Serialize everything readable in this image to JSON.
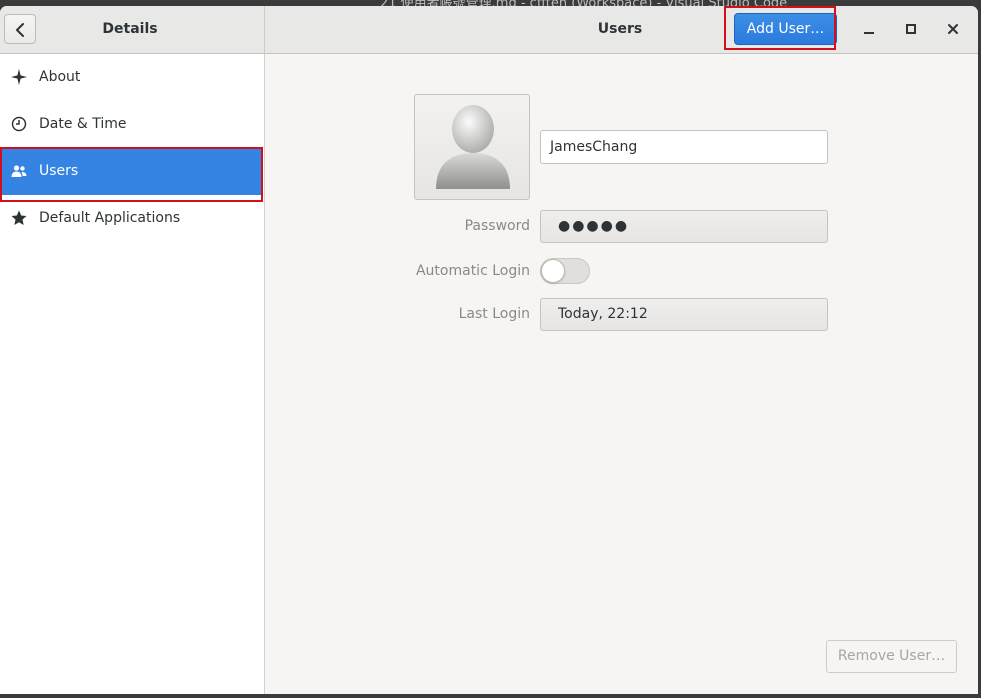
{
  "background_window_title": "21 使用者帳號管理.md - cfften (Workspace) - Visual Studio Code",
  "header": {
    "left_title": "Details",
    "center_title": "Users",
    "add_user_label": "Add User…"
  },
  "sidebar": {
    "items": [
      {
        "label": "About",
        "icon": "sparkle-icon"
      },
      {
        "label": "Date & Time",
        "icon": "clock-icon"
      },
      {
        "label": "Users",
        "icon": "users-icon",
        "selected": true
      },
      {
        "label": "Default Applications",
        "icon": "star-icon"
      }
    ]
  },
  "user": {
    "name": "JamesChang",
    "password_label": "Password",
    "password_value": "●●●●●",
    "auto_login_label": "Automatic Login",
    "auto_login_enabled": false,
    "last_login_label": "Last Login",
    "last_login_value": "Today, 22:12"
  },
  "remove_user_label": "Remove User…",
  "colors": {
    "accent": "#3584e4",
    "highlight": "#d20f1c"
  }
}
